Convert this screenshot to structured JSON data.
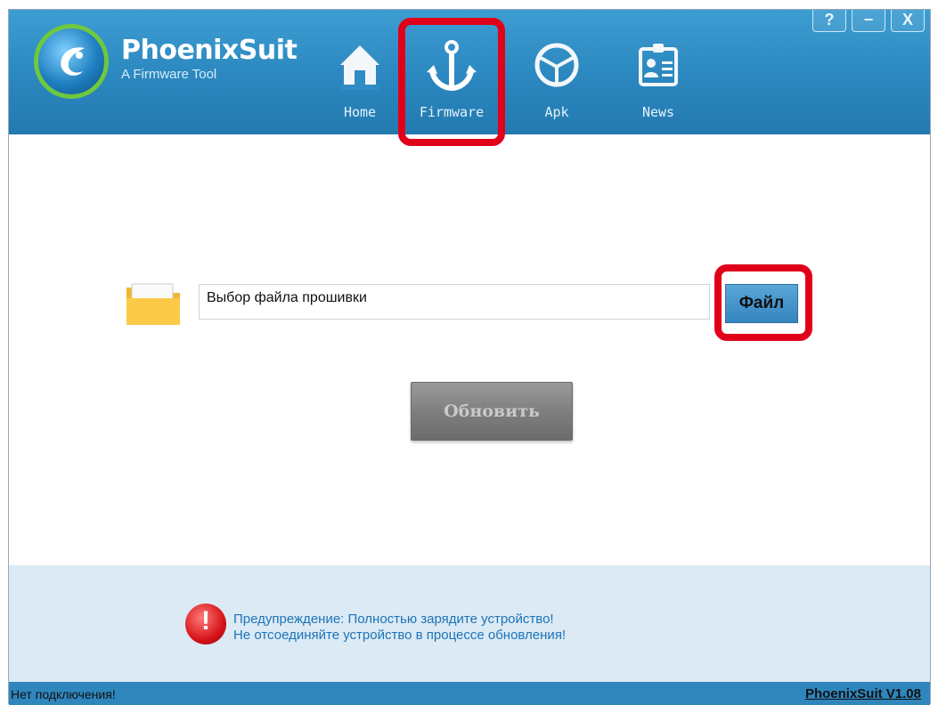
{
  "app": {
    "brand": "PhoenixSuit",
    "tagline": "A Firmware Tool"
  },
  "nav": {
    "items": [
      {
        "label": "Home",
        "icon": "home-icon"
      },
      {
        "label": "Firmware",
        "icon": "anchor-icon",
        "active": true
      },
      {
        "label": "Apk",
        "icon": "apk-icon"
      },
      {
        "label": "News",
        "icon": "news-icon"
      }
    ]
  },
  "window_controls": {
    "help": "?",
    "minimize": "−",
    "close": "X"
  },
  "firmware": {
    "file_placeholder": "Выбор файла прошивки",
    "file_button": "Файл",
    "update_button": "Обновить"
  },
  "warning": {
    "line1": "Предупреждение: Полностью зарядите устройство!",
    "line2": "Не отсоединяйте устройство в процессе обновления!"
  },
  "status": {
    "connection": "Нет подключения!",
    "version": "PhoenixSuit V1.08"
  },
  "colors": {
    "header": "#2b87bf",
    "highlight": "#e0001a",
    "warning_text": "#1d73b8",
    "status_bar": "#2f86bd"
  }
}
